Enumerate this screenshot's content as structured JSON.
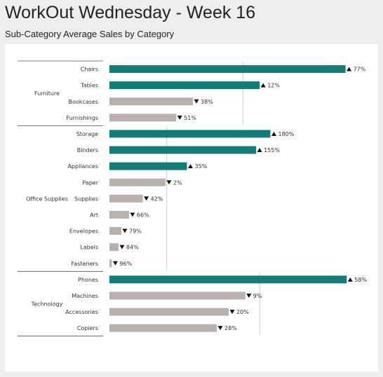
{
  "header": {
    "title": "WorkOut Wednesday - Week 16",
    "subtitle": "Sub-Category Average Sales by Category"
  },
  "colors": {
    "above": "#117d77",
    "below": "#bab0ac",
    "reference_line": "#cccccc",
    "divider": "#555555"
  },
  "chart_data": {
    "type": "bar",
    "orientation": "horizontal",
    "title": "Sub-Category Average Sales by Category",
    "groups": [
      {
        "name": "Furniture",
        "average": 0.56,
        "items": [
          {
            "label": "Chairs",
            "value": 0.99,
            "change": "77%",
            "direction": "up"
          },
          {
            "label": "Tables",
            "value": 0.63,
            "change": "12%",
            "direction": "up"
          },
          {
            "label": "Bookcases",
            "value": 0.35,
            "change": "38%",
            "direction": "down"
          },
          {
            "label": "Furnishings",
            "value": 0.28,
            "change": "51%",
            "direction": "down"
          }
        ]
      },
      {
        "name": "Office Supplies",
        "average": 0.24,
        "items": [
          {
            "label": "Storage",
            "value": 0.675,
            "change": "180%",
            "direction": "up"
          },
          {
            "label": "Binders",
            "value": 0.615,
            "change": "155%",
            "direction": "up"
          },
          {
            "label": "Appliances",
            "value": 0.325,
            "change": "35%",
            "direction": "up"
          },
          {
            "label": "Paper",
            "value": 0.235,
            "change": "2%",
            "direction": "down"
          },
          {
            "label": "Supplies",
            "value": 0.14,
            "change": "42%",
            "direction": "down"
          },
          {
            "label": "Art",
            "value": 0.082,
            "change": "66%",
            "direction": "down"
          },
          {
            "label": "Envelopes",
            "value": 0.05,
            "change": "79%",
            "direction": "down"
          },
          {
            "label": "Labels",
            "value": 0.038,
            "change": "84%",
            "direction": "down"
          },
          {
            "label": "Fasteners",
            "value": 0.01,
            "change": "96%",
            "direction": "down"
          }
        ]
      },
      {
        "name": "Technology",
        "average": 0.63,
        "items": [
          {
            "label": "Phones",
            "value": 0.995,
            "change": "58%",
            "direction": "up"
          },
          {
            "label": "Machines",
            "value": 0.57,
            "change": "9%",
            "direction": "down"
          },
          {
            "label": "Accessories",
            "value": 0.5,
            "change": "20%",
            "direction": "down"
          },
          {
            "label": "Copiers",
            "value": 0.45,
            "change": "28%",
            "direction": "down"
          }
        ]
      }
    ],
    "xlim": [
      0,
      1
    ],
    "grid": false,
    "legend": "none"
  }
}
